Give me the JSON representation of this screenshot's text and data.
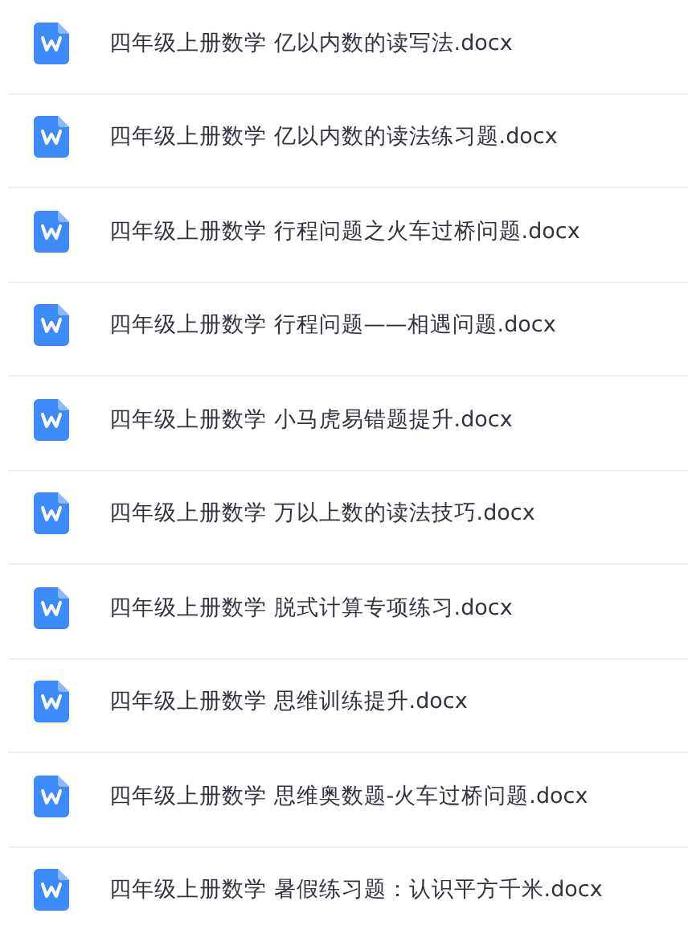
{
  "files": [
    {
      "name": "四年级上册数学 亿以内数的读写法.docx",
      "kind": "word"
    },
    {
      "name": "四年级上册数学 亿以内数的读法练习题.docx",
      "kind": "word"
    },
    {
      "name": "四年级上册数学 行程问题之火车过桥问题.docx",
      "kind": "word"
    },
    {
      "name": "四年级上册数学 行程问题——相遇问题.docx",
      "kind": "word"
    },
    {
      "name": "四年级上册数学 小马虎易错题提升.docx",
      "kind": "word"
    },
    {
      "name": "四年级上册数学 万以上数的读法技巧.docx",
      "kind": "word"
    },
    {
      "name": "四年级上册数学 脱式计算专项练习.docx",
      "kind": "word"
    },
    {
      "name": "四年级上册数学 思维训练提升.docx",
      "kind": "word"
    },
    {
      "name": "四年级上册数学 思维奥数题-火车过桥问题.docx",
      "kind": "word"
    },
    {
      "name": "四年级上册数学 暑假练习题：认识平方千米.docx",
      "kind": "word"
    }
  ]
}
